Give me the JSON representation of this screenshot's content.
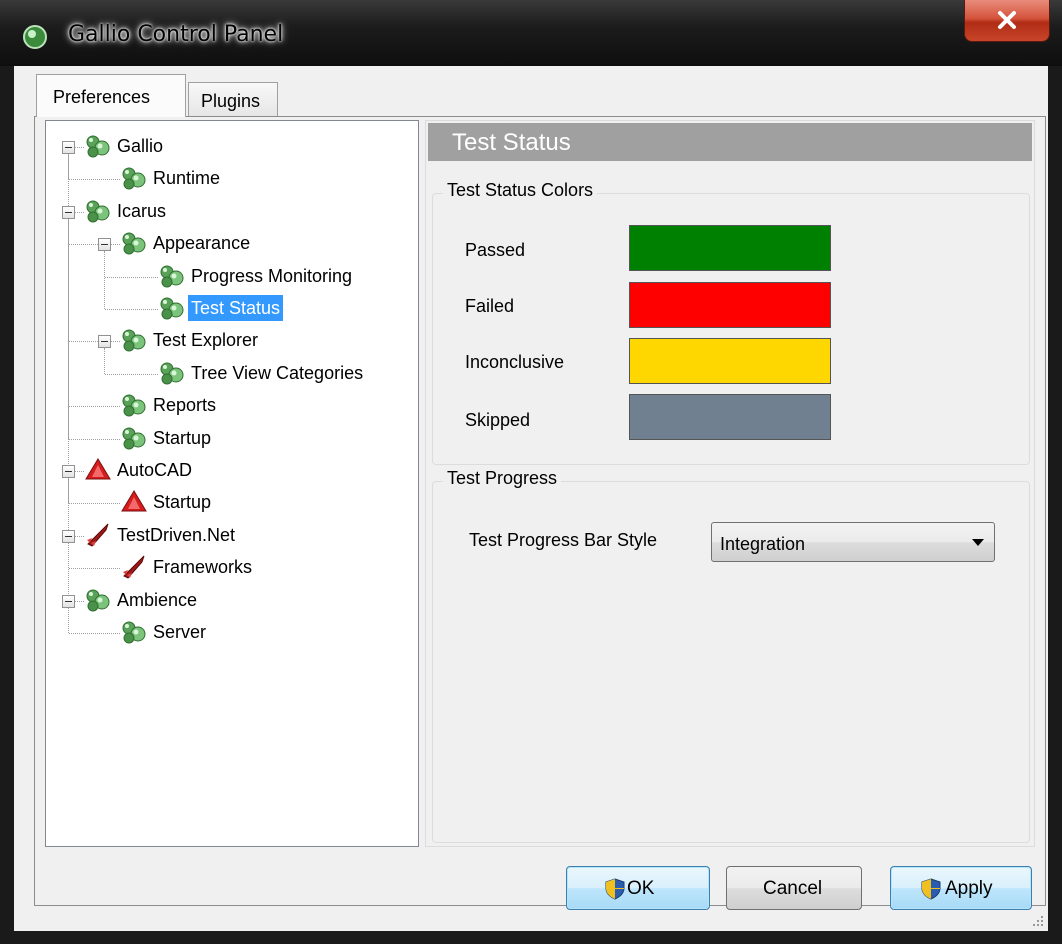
{
  "window": {
    "title": "Gallio Control Panel"
  },
  "tabs": [
    {
      "label": "Preferences",
      "selected": true
    },
    {
      "label": "Plugins",
      "selected": false
    }
  ],
  "tree": [
    {
      "label": "Gallio",
      "icon": "gallio-icon",
      "expanded": true
    },
    {
      "label": "Runtime",
      "icon": "gallio-icon"
    },
    {
      "label": "Icarus",
      "icon": "gallio-icon",
      "expanded": true
    },
    {
      "label": "Appearance",
      "icon": "gallio-icon",
      "expanded": true
    },
    {
      "label": "Progress Monitoring",
      "icon": "gallio-icon"
    },
    {
      "label": "Test Status",
      "icon": "gallio-icon",
      "selected": true
    },
    {
      "label": "Test Explorer",
      "icon": "gallio-icon",
      "expanded": true
    },
    {
      "label": "Tree View Categories",
      "icon": "gallio-icon"
    },
    {
      "label": "Reports",
      "icon": "gallio-icon"
    },
    {
      "label": "Startup",
      "icon": "gallio-icon"
    },
    {
      "label": "AutoCAD",
      "icon": "autocad-icon",
      "expanded": true
    },
    {
      "label": "Startup",
      "icon": "autocad-icon"
    },
    {
      "label": "TestDriven.Net",
      "icon": "rocket-icon",
      "expanded": true
    },
    {
      "label": "Frameworks",
      "icon": "rocket-icon"
    },
    {
      "label": "Ambience",
      "icon": "gallio-icon",
      "expanded": true
    },
    {
      "label": "Server",
      "icon": "gallio-icon"
    }
  ],
  "panel": {
    "title": "Test Status",
    "colors_group": {
      "title": "Test Status Colors",
      "items": [
        {
          "label": "Passed",
          "color": "#008000"
        },
        {
          "label": "Failed",
          "color": "#ff0000"
        },
        {
          "label": "Inconclusive",
          "color": "#ffd700"
        },
        {
          "label": "Skipped",
          "color": "#708090"
        }
      ]
    },
    "progress_group": {
      "title": "Test Progress",
      "bar_style_label": "Test Progress Bar Style",
      "bar_style_value": "Integration"
    }
  },
  "buttons": {
    "ok": "OK",
    "cancel": "Cancel",
    "apply": "Apply"
  }
}
